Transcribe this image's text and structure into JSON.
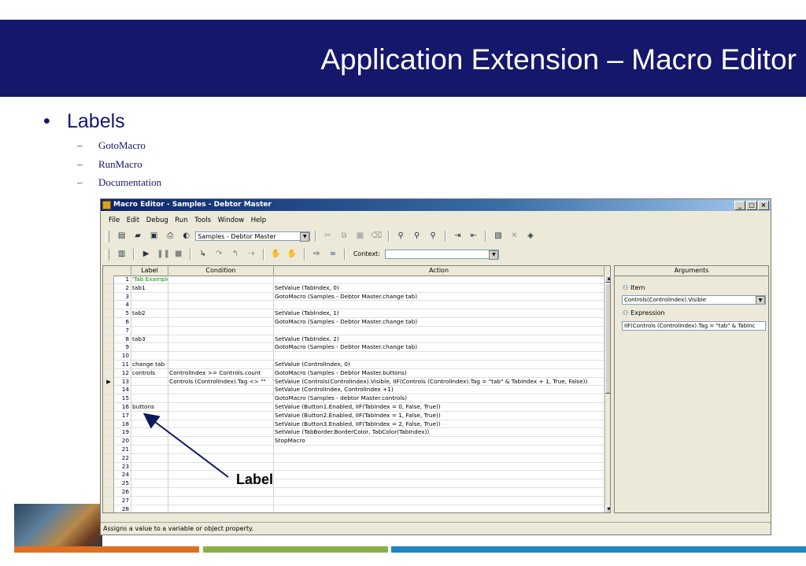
{
  "slide": {
    "title": "Application Extension – Macro Editor",
    "bullet_main": "Labels",
    "sub_items": [
      "GotoMacro",
      "RunMacro",
      "Documentation"
    ],
    "annotation": "Label"
  },
  "window": {
    "title": "Macro Editor - Samples - Debtor Master",
    "buttons": [
      "_",
      "□",
      "×"
    ],
    "menu": [
      "File",
      "Edit",
      "Debug",
      "Run",
      "Tools",
      "Window",
      "Help"
    ],
    "toolbar_combo": "Samples - Debtor Master",
    "context_label": "Context:",
    "context_value": ""
  },
  "grid": {
    "headers": [
      "Label",
      "Condition",
      "Action"
    ],
    "rows": [
      {
        "n": "1",
        "label": "'Tab Example",
        "cond": "",
        "action": ""
      },
      {
        "n": "2",
        "label": "tab1",
        "cond": "",
        "action": "SetValue (TabIndex, 0)"
      },
      {
        "n": "3",
        "label": "",
        "cond": "",
        "action": "GotoMacro (Samples - Debtor Master.change tab)"
      },
      {
        "n": "4",
        "label": "",
        "cond": "",
        "action": ""
      },
      {
        "n": "5",
        "label": "tab2",
        "cond": "",
        "action": "SetValue (TabIndex, 1)"
      },
      {
        "n": "6",
        "label": "",
        "cond": "",
        "action": "GotoMacro (Samples - Debtor Master.change tab)"
      },
      {
        "n": "7",
        "label": "",
        "cond": "",
        "action": ""
      },
      {
        "n": "8",
        "label": "tab3",
        "cond": "",
        "action": "SetValue (TabIndex, 2)"
      },
      {
        "n": "9",
        "label": "",
        "cond": "",
        "action": "GotoMacro (Samples - Debtor Master.change tab)"
      },
      {
        "n": "10",
        "label": "",
        "cond": "",
        "action": ""
      },
      {
        "n": "11",
        "label": "change tab",
        "cond": "",
        "action": "SetValue (ControlIndex, 0)"
      },
      {
        "n": "12",
        "label": "controls",
        "cond": "ControlIndex >= Controls.count",
        "action": "GotoMacro (Samples - Debtor Master.buttons)"
      },
      {
        "n": "13",
        "label": "",
        "cond": "Controls (ControlIndex).Tag <> \"\"",
        "action": "SetValue (Controls(ControlIndex).Visible, IIF(Controls (ControlIndex).Tag = \"tab\" & TabIndex + 1, True, False))"
      },
      {
        "n": "14",
        "label": "",
        "cond": "",
        "action": "SetValue (ControlIndex, ControlIndex +1)"
      },
      {
        "n": "15",
        "label": "",
        "cond": "",
        "action": "GotoMacro (Samples - debtor Master.controls)"
      },
      {
        "n": "16",
        "label": "buttons",
        "cond": "",
        "action": "SetValue (Button1.Enabled, IIF(TabIndex = 0, False, True))"
      },
      {
        "n": "17",
        "label": "",
        "cond": "",
        "action": "SetValue (Button2.Enabled, IIF(TabIndex = 1, False, True))"
      },
      {
        "n": "18",
        "label": "",
        "cond": "",
        "action": "SetValue (Button3.Enabled, IIF(TabIndex = 2, False, True))"
      },
      {
        "n": "19",
        "label": "",
        "cond": "",
        "action": "SetValue (TabBorder.BorderColor, TabColor(TabIndex))"
      },
      {
        "n": "20",
        "label": "",
        "cond": "",
        "action": "StopMacro"
      },
      {
        "n": "21",
        "label": "",
        "cond": "",
        "action": ""
      },
      {
        "n": "22",
        "label": "",
        "cond": "",
        "action": ""
      },
      {
        "n": "23",
        "label": "",
        "cond": "",
        "action": ""
      },
      {
        "n": "24",
        "label": "",
        "cond": "",
        "action": ""
      },
      {
        "n": "25",
        "label": "",
        "cond": "",
        "action": ""
      },
      {
        "n": "26",
        "label": "",
        "cond": "",
        "action": ""
      },
      {
        "n": "27",
        "label": "",
        "cond": "",
        "action": ""
      },
      {
        "n": "28",
        "label": "",
        "cond": "",
        "action": ""
      }
    ],
    "current_row_index": 12
  },
  "arguments": {
    "header": "Arguments",
    "item_label": "Item",
    "item_value": "Controls(ControlIndex).Visible",
    "expression_label": "Expression",
    "expression_value": "IIF(Controls (ControlIndex).Tag = \"tab\" & TabInc"
  },
  "statusbar": {
    "text": "Assigns a value to a variable or object property."
  },
  "colors": {
    "header_band": "#14176a",
    "title_text": "#ffffff",
    "bullet_text": "#14176a",
    "comment_green": "#0a8a0a"
  }
}
